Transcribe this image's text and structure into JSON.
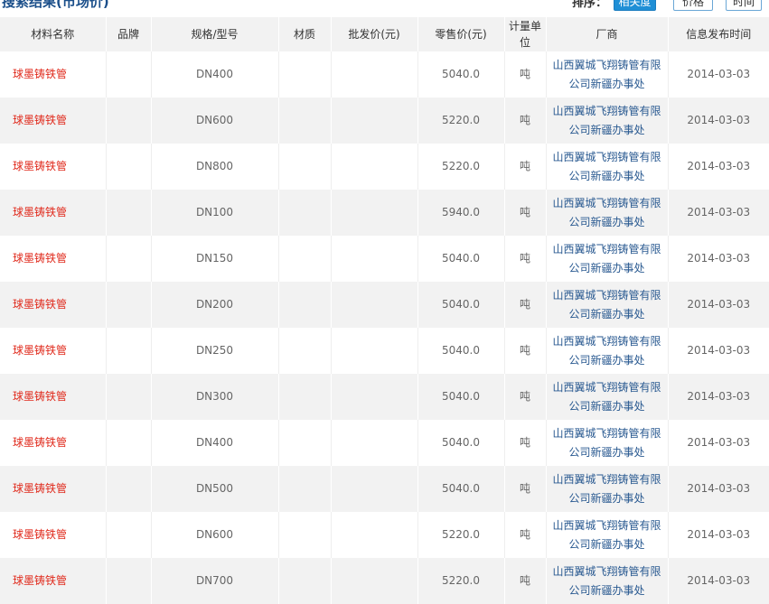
{
  "header": {
    "title": "搜索结果(市场价)",
    "sort_label": "排序：",
    "sort_buttons": [
      "相关度",
      "价格",
      "时间"
    ]
  },
  "table": {
    "columns": [
      "材料名称",
      "品牌",
      "规格/型号",
      "材质",
      "批发价(元)",
      "零售价(元)",
      "计量单位",
      "厂商",
      "信息发布时间"
    ],
    "rows": [
      {
        "name": "球墨铸铁管",
        "brand": "",
        "spec": "DN400",
        "material": "",
        "wholesale": "",
        "retail": "5040.0",
        "unit": "吨",
        "vendor": "山西翼城飞翔铸管有限公司新疆办事处",
        "date": "2014-03-03"
      },
      {
        "name": "球墨铸铁管",
        "brand": "",
        "spec": "DN600",
        "material": "",
        "wholesale": "",
        "retail": "5220.0",
        "unit": "吨",
        "vendor": "山西翼城飞翔铸管有限公司新疆办事处",
        "date": "2014-03-03"
      },
      {
        "name": "球墨铸铁管",
        "brand": "",
        "spec": "DN800",
        "material": "",
        "wholesale": "",
        "retail": "5220.0",
        "unit": "吨",
        "vendor": "山西翼城飞翔铸管有限公司新疆办事处",
        "date": "2014-03-03"
      },
      {
        "name": "球墨铸铁管",
        "brand": "",
        "spec": "DN100",
        "material": "",
        "wholesale": "",
        "retail": "5940.0",
        "unit": "吨",
        "vendor": "山西翼城飞翔铸管有限公司新疆办事处",
        "date": "2014-03-03"
      },
      {
        "name": "球墨铸铁管",
        "brand": "",
        "spec": "DN150",
        "material": "",
        "wholesale": "",
        "retail": "5040.0",
        "unit": "吨",
        "vendor": "山西翼城飞翔铸管有限公司新疆办事处",
        "date": "2014-03-03"
      },
      {
        "name": "球墨铸铁管",
        "brand": "",
        "spec": "DN200",
        "material": "",
        "wholesale": "",
        "retail": "5040.0",
        "unit": "吨",
        "vendor": "山西翼城飞翔铸管有限公司新疆办事处",
        "date": "2014-03-03"
      },
      {
        "name": "球墨铸铁管",
        "brand": "",
        "spec": "DN250",
        "material": "",
        "wholesale": "",
        "retail": "5040.0",
        "unit": "吨",
        "vendor": "山西翼城飞翔铸管有限公司新疆办事处",
        "date": "2014-03-03"
      },
      {
        "name": "球墨铸铁管",
        "brand": "",
        "spec": "DN300",
        "material": "",
        "wholesale": "",
        "retail": "5040.0",
        "unit": "吨",
        "vendor": "山西翼城飞翔铸管有限公司新疆办事处",
        "date": "2014-03-03"
      },
      {
        "name": "球墨铸铁管",
        "brand": "",
        "spec": "DN400",
        "material": "",
        "wholesale": "",
        "retail": "5040.0",
        "unit": "吨",
        "vendor": "山西翼城飞翔铸管有限公司新疆办事处",
        "date": "2014-03-03"
      },
      {
        "name": "球墨铸铁管",
        "brand": "",
        "spec": "DN500",
        "material": "",
        "wholesale": "",
        "retail": "5040.0",
        "unit": "吨",
        "vendor": "山西翼城飞翔铸管有限公司新疆办事处",
        "date": "2014-03-03"
      },
      {
        "name": "球墨铸铁管",
        "brand": "",
        "spec": "DN600",
        "material": "",
        "wholesale": "",
        "retail": "5220.0",
        "unit": "吨",
        "vendor": "山西翼城飞翔铸管有限公司新疆办事处",
        "date": "2014-03-03"
      },
      {
        "name": "球墨铸铁管",
        "brand": "",
        "spec": "DN700",
        "material": "",
        "wholesale": "",
        "retail": "5220.0",
        "unit": "吨",
        "vendor": "山西翼城飞翔铸管有限公司新疆办事处",
        "date": "2014-03-03"
      }
    ]
  }
}
